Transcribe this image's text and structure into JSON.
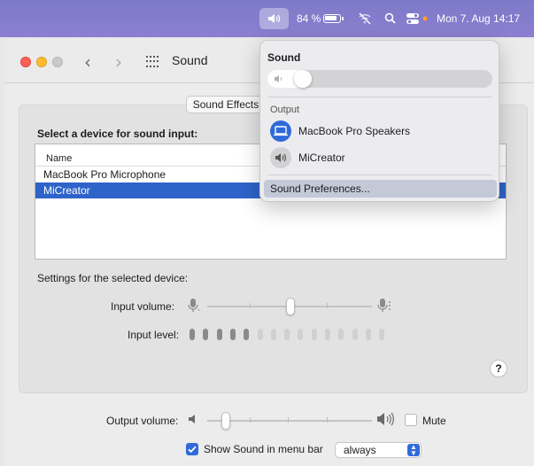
{
  "menubar": {
    "battery_percent": "84 %",
    "datetime": "Mon 7. Aug  14:17",
    "icons": [
      "volume-icon",
      "battery-icon",
      "wifi-off-icon",
      "search-icon",
      "control-center-icon"
    ]
  },
  "window": {
    "title": "Sound",
    "nav_back": "‹",
    "nav_forward": "›"
  },
  "tabs": {
    "sound_effects": "Sound Effects"
  },
  "input": {
    "heading": "Select a device for sound input:",
    "column_name": "Name",
    "devices": [
      {
        "name": "MacBook Pro Microphone",
        "selected": false
      },
      {
        "name": "MiCreator",
        "selected": true
      }
    ],
    "settings_label": "Settings for the selected device:",
    "input_volume_label": "Input volume:",
    "input_volume_value": 0.5,
    "input_level_label": "Input level:",
    "input_level_active_bars": 5,
    "input_level_total_bars": 15
  },
  "output": {
    "volume_label": "Output volume:",
    "volume_value": 0.12,
    "mute_label": "Mute",
    "mute_checked": false
  },
  "menubar_option": {
    "label": "Show Sound in menu bar",
    "checked": true,
    "select_value": "always"
  },
  "help": "?",
  "dropdown": {
    "title": "Sound",
    "volume_value": 0.12,
    "output_heading": "Output",
    "devices": [
      {
        "name": "MacBook Pro Speakers",
        "active": true,
        "icon": "laptop-icon"
      },
      {
        "name": "MiCreator",
        "active": false,
        "icon": "speaker-icon"
      }
    ],
    "preferences_label": "Sound Preferences..."
  },
  "colors": {
    "accent": "#2e63c9",
    "menubar": "#8380cc",
    "checkbox_blue": "#2f6ad8"
  }
}
